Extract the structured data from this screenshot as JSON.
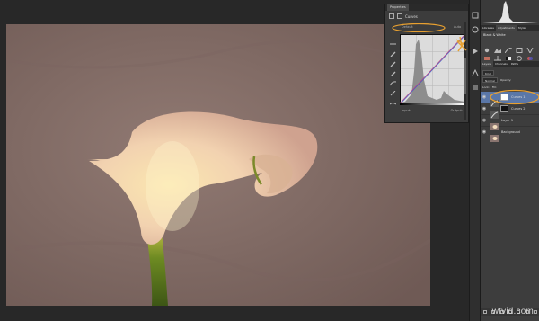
{
  "properties_panel": {
    "tab_label": "Properties",
    "header_label": "Curves",
    "preset_value": "Default",
    "auto_label": "Auto",
    "input_label": "Input:",
    "output_label": "Output:"
  },
  "adjustments_panel": {
    "tabs": [
      "Libraries",
      "Adjustments",
      "Styles"
    ],
    "active_tab": "Adjustments",
    "title": "Black & White"
  },
  "layers_panel": {
    "tabs": [
      "Layers",
      "Channels",
      "Paths"
    ],
    "kind_filter": "Kind",
    "blend_mode": "Normal",
    "opacity_label": "Opacity:",
    "lock_label": "Lock:",
    "fill_label": "Fill:",
    "layers": [
      {
        "name": "Curves 1",
        "selected": true
      },
      {
        "name": "Curves 2",
        "selected": false
      },
      {
        "name": "Layer 1",
        "selected": false
      },
      {
        "name": "Background",
        "selected": false
      }
    ]
  },
  "annotation_color": "#e8a030",
  "watermark": "wtvid.com"
}
